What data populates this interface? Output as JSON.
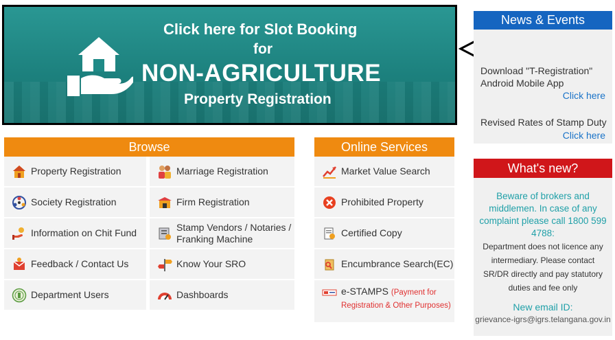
{
  "banner": {
    "line1": "Click here for Slot Booking",
    "line2": "for",
    "line3": "NON-AGRICULTURE",
    "line4": "Property Registration"
  },
  "browse": {
    "title": "Browse",
    "items": [
      {
        "label": "Property Registration",
        "icon": "house-icon"
      },
      {
        "label": "Marriage Registration",
        "icon": "couple-icon"
      },
      {
        "label": "Society Registration",
        "icon": "society-icon"
      },
      {
        "label": "Firm Registration",
        "icon": "firm-icon"
      },
      {
        "label": "Information on Chit Fund",
        "icon": "chit-fund-icon"
      },
      {
        "label": "Stamp Vendors / Notaries / Franking Machine",
        "icon": "stamp-icon"
      },
      {
        "label": "Feedback / Contact Us",
        "icon": "feedback-icon"
      },
      {
        "label": "Know Your SRO",
        "icon": "signpost-icon"
      },
      {
        "label": "Department Users",
        "icon": "department-seal-icon"
      },
      {
        "label": "Dashboards",
        "icon": "gauge-icon"
      }
    ]
  },
  "services": {
    "title": "Online Services",
    "items": [
      {
        "label": "Market Value Search",
        "icon": "chart-icon"
      },
      {
        "label": "Prohibited Property",
        "icon": "prohibited-icon"
      },
      {
        "label": "Certified Copy",
        "icon": "certificate-icon"
      },
      {
        "label": "Encumbrance Search(EC)",
        "icon": "encumbrance-icon"
      },
      {
        "label": "e-STAMPS",
        "note": "(Payment for Registration & Other Purposes)",
        "icon": "estamps-icon"
      }
    ]
  },
  "news": {
    "title": "News & Events",
    "item1": "Download \"T-Registration\" Android Mobile App",
    "link1": "Click here",
    "item2": "Revised Rates of Stamp Duty",
    "link2": "Click here"
  },
  "whatsnew": {
    "title": "What's new?",
    "warning": "Beware of brokers and middlemen. In case of any complaint please call 1800 599 4788:",
    "body": "Department does not licence any intermediary.  Please contact SR/DR directly and pay statutory duties and fee only",
    "email_heading": "New email ID:",
    "email": "grievance-igrs@igrs.telangana.gov.in"
  },
  "colors": {
    "banner_teal": "#1f8a87",
    "orange": "#ef8a10",
    "news_blue": "#1565c0",
    "whatsnew_red": "#d0161a",
    "link_blue": "#1a73c8",
    "teal_text": "#20a0a8"
  }
}
